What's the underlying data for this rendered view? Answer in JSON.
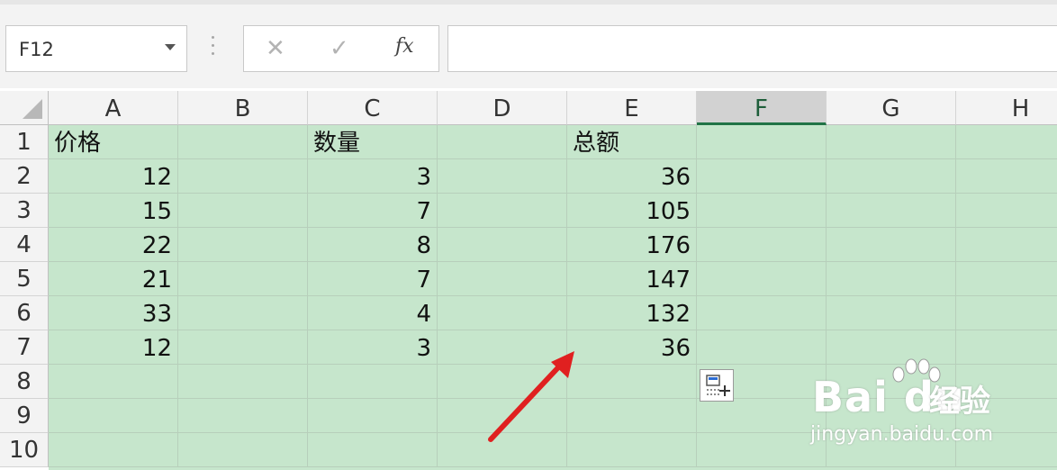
{
  "name_box": {
    "value": "F12"
  },
  "formula_bar": {
    "cancel_icon": "✕",
    "enter_icon": "✓",
    "fx_label": "fx",
    "value": ""
  },
  "columns": [
    "A",
    "B",
    "C",
    "D",
    "E",
    "F",
    "G",
    "H"
  ],
  "selected_column": "F",
  "rows": [
    "1",
    "2",
    "3",
    "4",
    "5",
    "6",
    "7",
    "8",
    "9",
    "10"
  ],
  "cells": [
    {
      "ref": "A1",
      "value": "价格"
    },
    {
      "ref": "C1",
      "value": "数量"
    },
    {
      "ref": "E1",
      "value": "总额"
    },
    {
      "ref": "A2",
      "value": "12"
    },
    {
      "ref": "C2",
      "value": "3"
    },
    {
      "ref": "E2",
      "value": "36"
    },
    {
      "ref": "A3",
      "value": "15"
    },
    {
      "ref": "C3",
      "value": "7"
    },
    {
      "ref": "E3",
      "value": "105"
    },
    {
      "ref": "A4",
      "value": "22"
    },
    {
      "ref": "C4",
      "value": "8"
    },
    {
      "ref": "E4",
      "value": "176"
    },
    {
      "ref": "A5",
      "value": "21"
    },
    {
      "ref": "C5",
      "value": "7"
    },
    {
      "ref": "E5",
      "value": "147"
    },
    {
      "ref": "A6",
      "value": "33"
    },
    {
      "ref": "C6",
      "value": "4"
    },
    {
      "ref": "E6",
      "value": "132"
    },
    {
      "ref": "A7",
      "value": "12"
    },
    {
      "ref": "C7",
      "value": "3"
    },
    {
      "ref": "E7",
      "value": "36"
    }
  ],
  "watermark": {
    "logo_text": "Bai du",
    "logo_suffix": "经验",
    "url": "jingyan.baidu.com"
  },
  "colors": {
    "selection_fill": "#c6e6cc",
    "header_accent": "#217346",
    "arrow": "#e02020"
  },
  "icons": {
    "paste_options": "paste-options-icon",
    "annotation": "red-arrow"
  }
}
